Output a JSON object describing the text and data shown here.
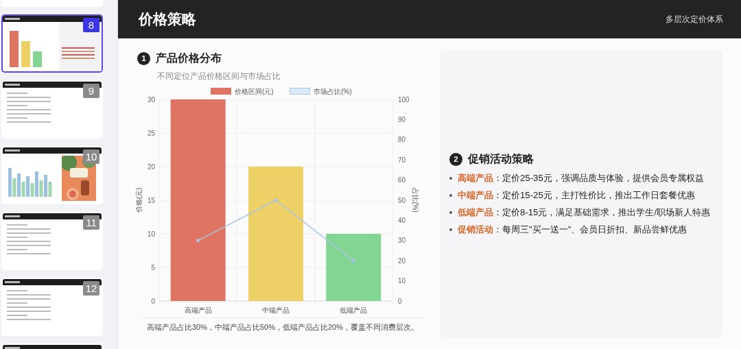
{
  "sidebar": {
    "slides": [
      {
        "kind": "blank",
        "selected": false
      },
      {
        "number": "8",
        "kind": "chart",
        "selected": true
      },
      {
        "number": "9",
        "kind": "text",
        "selected": false
      },
      {
        "number": "10",
        "kind": "chart-photo",
        "selected": false
      },
      {
        "number": "11",
        "kind": "text",
        "selected": false
      },
      {
        "number": "12",
        "kind": "text",
        "selected": false
      },
      {
        "kind": "text",
        "selected": false
      }
    ]
  },
  "header": {
    "title": "价格策略",
    "subtitle": "多层次定价体系"
  },
  "section_1": {
    "number": "1",
    "title": "产品价格分布",
    "description": "不同定位产品价格区间与市场占比",
    "chart_data": {
      "type": "bar",
      "grid": true,
      "legend": true,
      "categories": [
        "高端产品",
        "中端产品",
        "低端产品"
      ],
      "ylabel": "价格(元)",
      "y2label": "占比(%)",
      "ylim": [
        0,
        30
      ],
      "yticks": [
        0,
        5,
        10,
        15,
        20,
        25,
        30
      ],
      "y2lim": [
        0,
        100
      ],
      "y2ticks": [
        0,
        10,
        20,
        30,
        40,
        50,
        60,
        70,
        80,
        90,
        100
      ],
      "series": [
        {
          "name": "价格区间(元)",
          "type": "bar",
          "colors": [
            "#e07462",
            "#eed166",
            "#82d593"
          ],
          "values": [
            30,
            20,
            10
          ]
        },
        {
          "name": "市场占比(%)",
          "type": "line",
          "color": "#a9c6e3",
          "axis": "y2",
          "values": [
            30,
            50,
            20
          ]
        }
      ]
    },
    "caption": "高端产品占比30%，中端产品占比50%，低端产品占比20%，覆盖不同消费层次。"
  },
  "section_2": {
    "number": "2",
    "title": "促销活动策略",
    "items": [
      {
        "label": "高端产品",
        "text": "：定价25-35元，强调品质与体验，提供会员专属权益"
      },
      {
        "label": "中端产品",
        "text": "：定价15-25元，主打性价比，推出工作日套餐优惠"
      },
      {
        "label": "低端产品",
        "text": "：定价8-15元，满足基础需求，推出学生/职场新人特惠"
      },
      {
        "label": "促销活动",
        "text": "：每周三\"买一送一\"、会员日折扣、新品尝鲜优惠"
      }
    ]
  }
}
